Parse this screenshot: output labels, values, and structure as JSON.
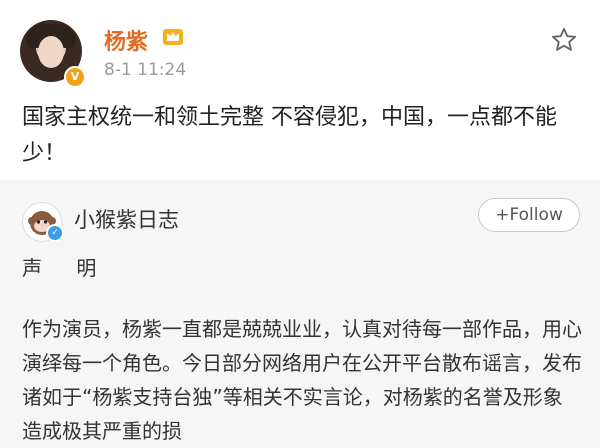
{
  "post": {
    "username": "杨紫",
    "timestamp": "8-1 11:24",
    "body": "国家主权统一和领土完整 不容侵犯，中国，一点都不能少！"
  },
  "repost": {
    "username": "小猴紫日志",
    "follow_label": "+Follow",
    "statement_title": "声 明",
    "statement_text": "作为演员，杨紫一直都是兢兢业业，认真对待每一部作品，用心演绎每一个角色。今日部分网络用户在公开平台散布谣言，发布诸如于“杨紫支持台独”等相关不实言论，对杨紫的名誉及形象造成极其严重的损"
  }
}
